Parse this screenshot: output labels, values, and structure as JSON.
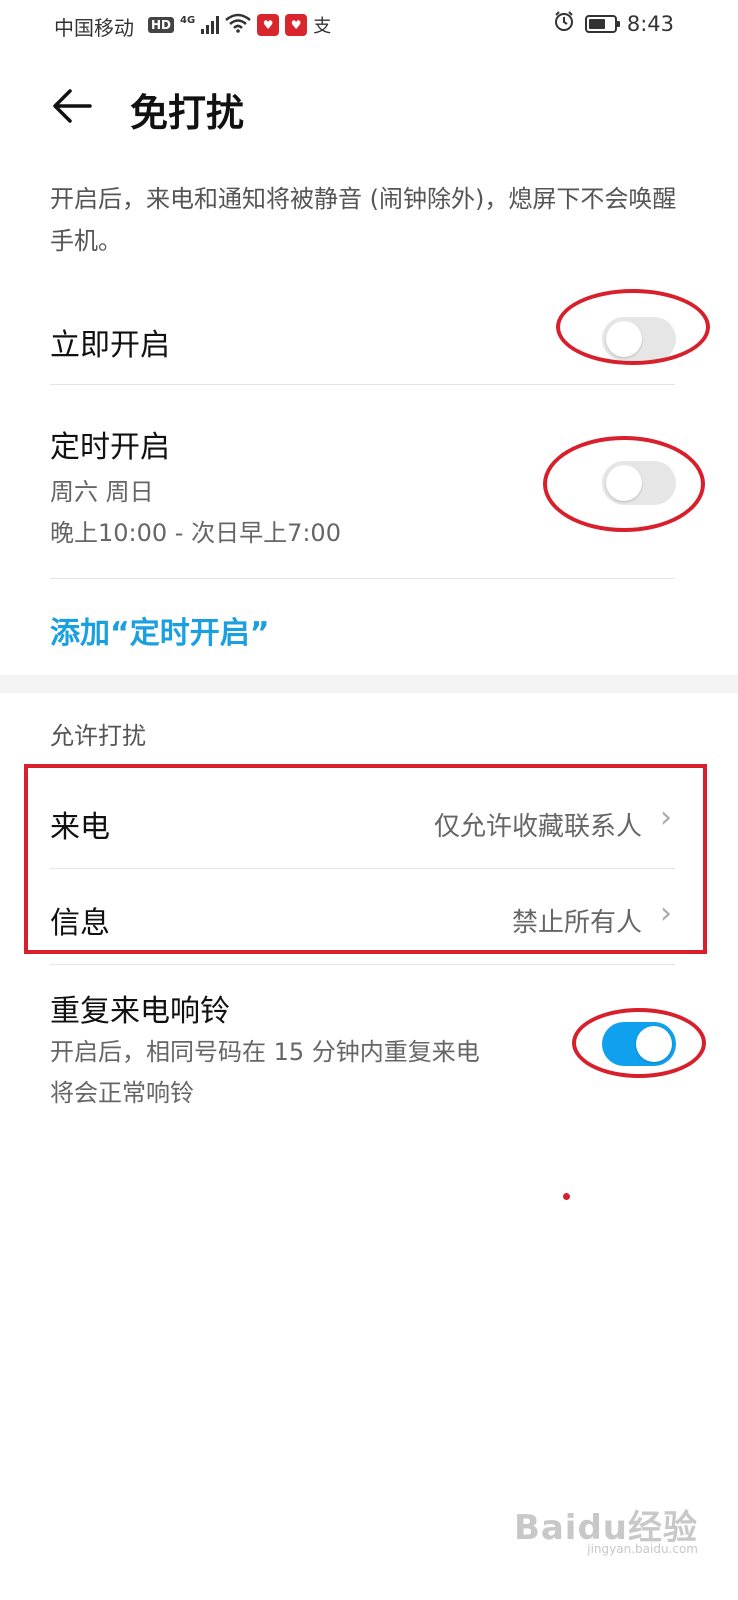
{
  "status_bar": {
    "carrier": "中国移动",
    "hd": "HD",
    "network": "4G",
    "app_badge_1": "♥",
    "app_badge_2": "♥",
    "alipay": "支",
    "time": "8:43"
  },
  "header": {
    "title": "免打扰"
  },
  "description": "开启后，来电和通知将被静音 (闹钟除外)，熄屏下不会唤醒手机。",
  "settings": {
    "immediate": {
      "title": "立即开启",
      "enabled": false
    },
    "scheduled": {
      "title": "定时开启",
      "days": "周六 周日",
      "time_range": "晚上10:00 - 次日早上7:00",
      "enabled": false
    },
    "add_schedule_label": "添加“定时开启”"
  },
  "allow_section": {
    "header": "允许打扰",
    "calls": {
      "label": "来电",
      "value": "仅允许收藏联系人"
    },
    "messages": {
      "label": "信息",
      "value": "禁止所有人"
    },
    "repeat_calls": {
      "title": "重复来电响铃",
      "desc_line1": "开启后，相同号码在 15 分钟内重复来电",
      "desc_line2": "将会正常响铃",
      "enabled": true
    }
  },
  "watermark": {
    "text": "Baidu经验",
    "sub": "jingyan.baidu.com"
  },
  "colors": {
    "accent": "#1a9fe0",
    "toggle_on": "#0fa0ee",
    "annotation_red": "#d7202c"
  }
}
